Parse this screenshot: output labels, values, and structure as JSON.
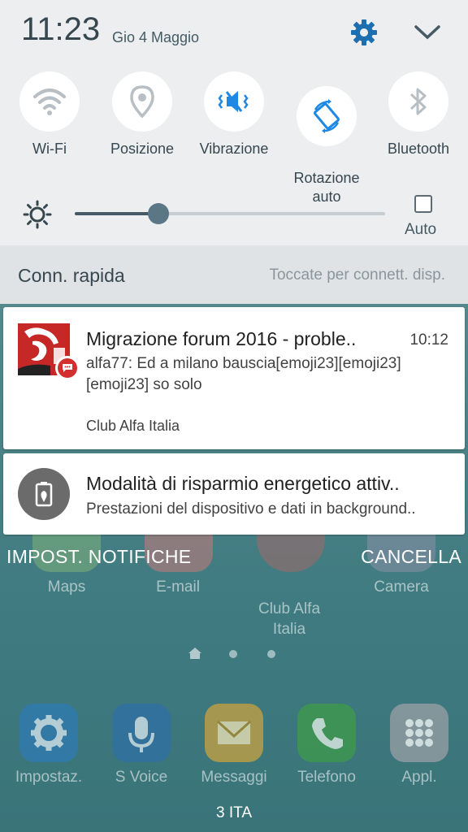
{
  "status": {
    "time": "11:23",
    "date": "Gio 4 Maggio"
  },
  "quick_settings": [
    {
      "label": "Wi-Fi",
      "icon": "wifi-icon"
    },
    {
      "label": "Posizione",
      "icon": "location-icon"
    },
    {
      "label": "Vibrazione",
      "icon": "vibrate-icon"
    },
    {
      "label": "Rotazione\nauto",
      "icon": "rotate-icon"
    },
    {
      "label": "Bluetooth",
      "icon": "bluetooth-icon"
    }
  ],
  "brightness": {
    "level": 0.27,
    "auto_label": "Auto",
    "auto_checked": false
  },
  "quick_connect": {
    "title": "Conn. rapida",
    "hint": "Toccate per connett. disp."
  },
  "notifications": [
    {
      "title": "Migrazione forum 2016 - proble..",
      "time": "10:12",
      "text": "alfa77: Ed a milano bauscia[emoji23][emoji23]\n[emoji23] so solo",
      "app": "Club Alfa Italia",
      "icon": "club-alfa-icon"
    },
    {
      "title": "Modalità di risparmio energetico attiv..",
      "text": "Prestazioni del dispositivo e dati in background..",
      "icon": "battery-saver-icon"
    }
  ],
  "actions": {
    "settings": "IMPOST. NOTIFICHE",
    "clear": "CANCELLA"
  },
  "home_apps_row1": [
    "Maps",
    "E-mail",
    "Club Alfa\nItalia",
    "Camera"
  ],
  "dock": [
    "Impostaz.",
    "S Voice",
    "Messaggi",
    "Telefono",
    "Appl."
  ],
  "carrier": "3 ITA",
  "colors": {
    "accent": "#1e88e5",
    "shade_bg": "#eceef0",
    "alfa_red": "#c62828"
  }
}
